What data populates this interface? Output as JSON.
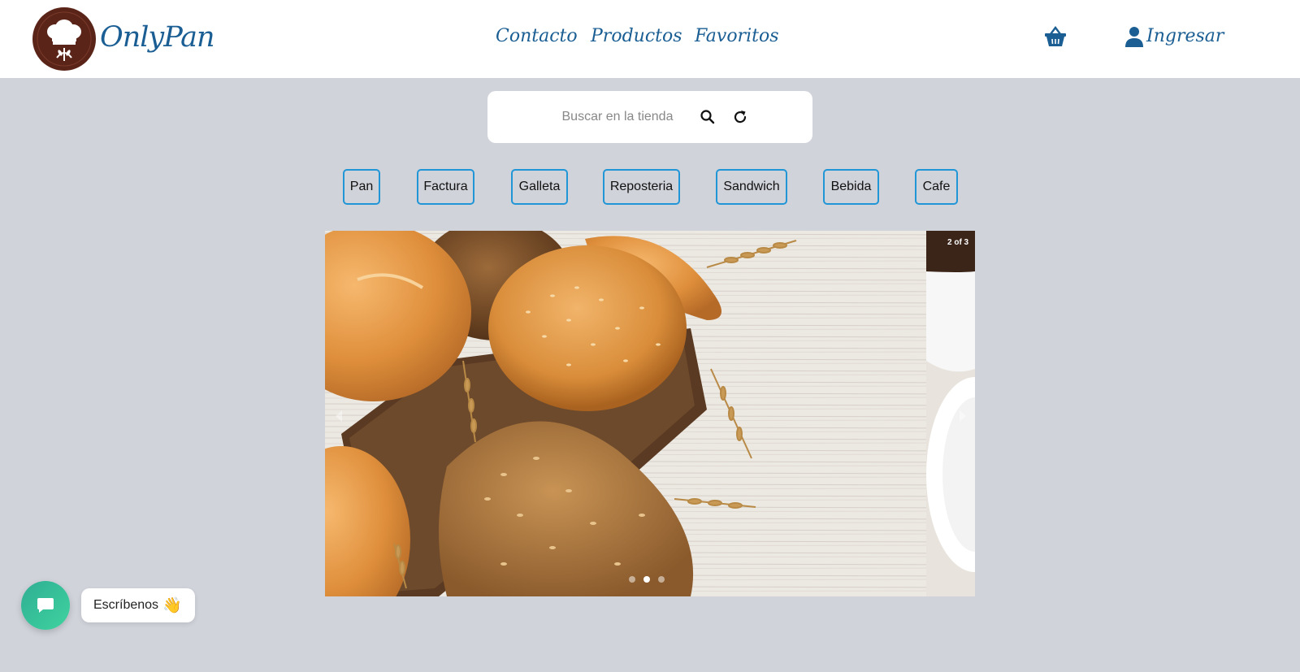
{
  "brand": {
    "name": "OnlyPan"
  },
  "nav": {
    "links": [
      {
        "label": "Contacto"
      },
      {
        "label": "Productos"
      },
      {
        "label": "Favoritos"
      }
    ],
    "cart_icon": "basket-icon",
    "login_label": "Ingresar",
    "user_icon": "user-icon"
  },
  "search": {
    "placeholder": "Buscar en la tienda",
    "value": "",
    "search_icon": "search-icon",
    "refresh_icon": "refresh-icon"
  },
  "categories": [
    "Pan",
    "Factura",
    "Galleta",
    "Reposteria",
    "Sandwich",
    "Bebida",
    "Cafe"
  ],
  "carousel": {
    "counter": "2 of 3",
    "current_slide": 2,
    "total_slides": 3,
    "slide_subject": "bread rolls on wooden board with wheat"
  },
  "chat": {
    "label": "Escríbenos",
    "emoji": "👋",
    "icon": "chat-icon"
  },
  "colors": {
    "background": "#d1d3db",
    "nav_text": "#1a5e93",
    "category_border": "#2196d6",
    "chat_gradient_start": "#2fae93",
    "chat_gradient_end": "#3fd39f"
  }
}
